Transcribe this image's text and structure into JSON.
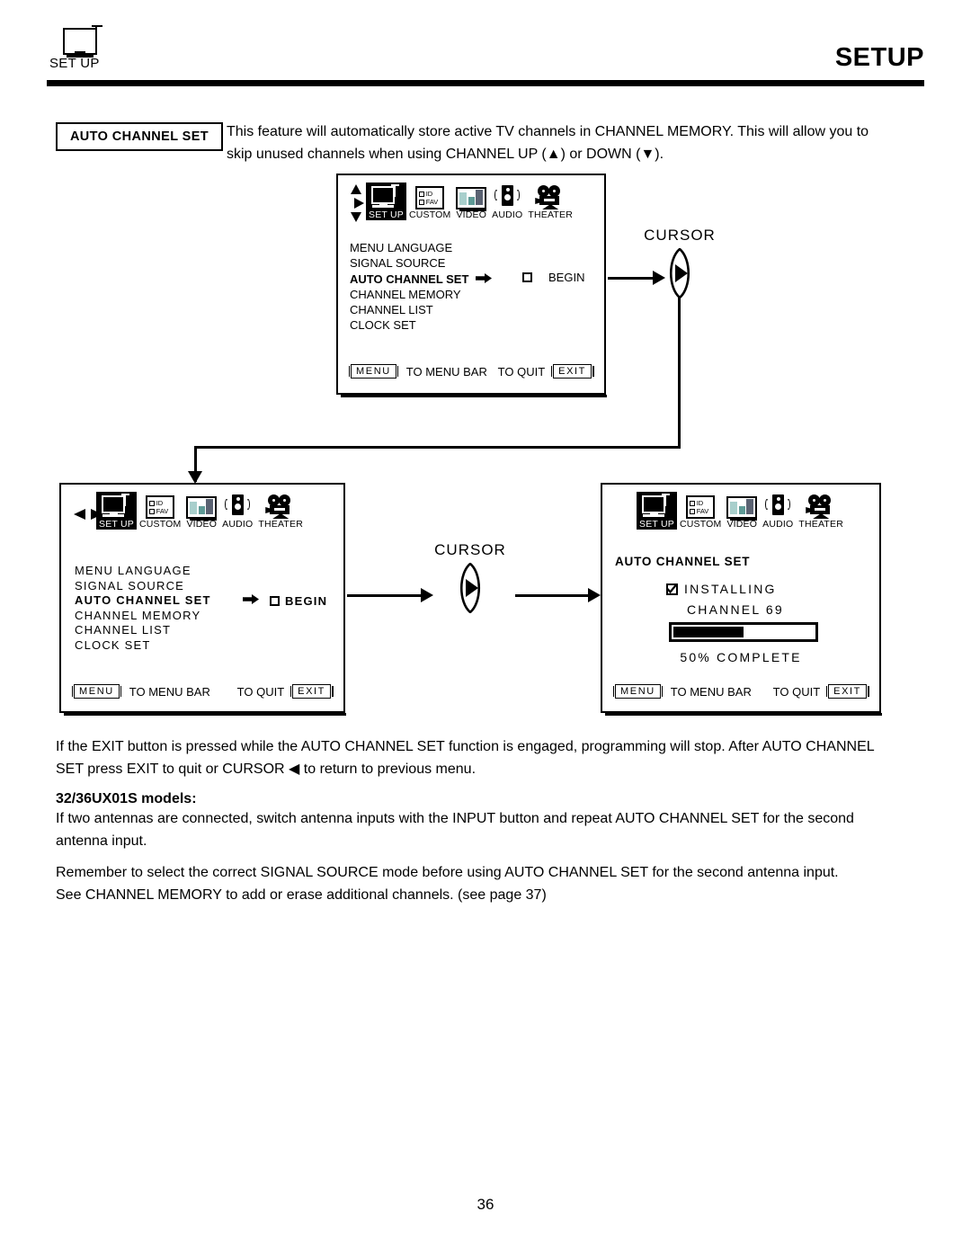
{
  "header": {
    "tab_label": "SET UP",
    "page_title": "SETUP",
    "tab_icon": "tv-antenna-icon"
  },
  "intro": {
    "feature_label": "AUTO CHANNEL SET",
    "line1": "This feature will automatically store active TV channels in CHANNEL MEMORY.  This will allow you to",
    "line2": "skip unused channels when using CHANNEL UP (▲) or DOWN (▼)."
  },
  "menu_bar": {
    "items": [
      {
        "label": "SET UP",
        "icon": "tv-antenna-icon",
        "active": true
      },
      {
        "label": "CUSTOM",
        "icon": "id-fav-icon",
        "active": false
      },
      {
        "label": "VIDEO",
        "icon": "video-bars-icon",
        "active": false
      },
      {
        "label": "AUDIO",
        "icon": "speaker-icon",
        "active": false
      },
      {
        "label": "THEATER",
        "icon": "movie-camera-icon",
        "active": false
      }
    ]
  },
  "panel1": {
    "nav_arrows": "up-right-down-arrows",
    "menu_items": [
      "MENU LANGUAGE",
      "SIGNAL SOURCE",
      "AUTO CHANNEL SET",
      "CHANNEL MEMORY",
      "CHANNEL LIST",
      "CLOCK SET"
    ],
    "selected_index": 2,
    "selected_arrow": "right-arrow-icon",
    "checkbox_state": "unchecked",
    "begin_label": "BEGIN",
    "footer": {
      "menu_key": "MENU",
      "menu_text": "TO MENU BAR",
      "quit_text": "TO QUIT",
      "exit_key": "EXIT"
    }
  },
  "panel2": {
    "nav_arrows": "left-right-arrows",
    "menu_items": [
      "MENU LANGUAGE",
      "SIGNAL SOURCE",
      "AUTO CHANNEL SET",
      "CHANNEL MEMORY",
      "CHANNEL LIST",
      "CLOCK SET"
    ],
    "selected_index": 2,
    "selected_arrow": "right-arrow-icon",
    "checkbox_state": "unchecked",
    "begin_label": "BEGIN",
    "footer": {
      "menu_key": "MENU",
      "menu_text": "TO MENU BAR",
      "quit_text": "TO QUIT",
      "exit_key": "EXIT"
    }
  },
  "panel3": {
    "title": "AUTO CHANNEL SET",
    "checkbox_state": "checked",
    "status_label": "INSTALLING",
    "channel_label": "CHANNEL  69",
    "progress_percent": 50,
    "progress_label": "50% COMPLETE",
    "footer": {
      "menu_key": "MENU",
      "menu_text": "TO MENU BAR",
      "quit_text": "TO QUIT",
      "exit_key": "EXIT"
    }
  },
  "cursor1": {
    "label": "CURSOR",
    "icon": "cursor-right-button"
  },
  "cursor2": {
    "label": "CURSOR",
    "icon": "cursor-right-button"
  },
  "notes": {
    "p1_line1": "If the EXIT button is pressed while the AUTO CHANNEL SET function is engaged, programming will stop. After AUTO CHANNEL",
    "p1_line2": "SET press EXIT to quit or CURSOR ◀ to return to previous menu.",
    "models_heading": "32/36UX01S models:",
    "p2_line1": "If two antennas are connected, switch antenna inputs with the INPUT button and repeat AUTO CHANNEL SET for the second",
    "p2_line2": "antenna input.",
    "p3_line1": "Remember to select the correct SIGNAL SOURCE mode before using AUTO CHANNEL SET for the second antenna input.",
    "p3_line2": "See CHANNEL MEMORY to add or erase additional channels. (see page 37)"
  },
  "page_number": "36"
}
